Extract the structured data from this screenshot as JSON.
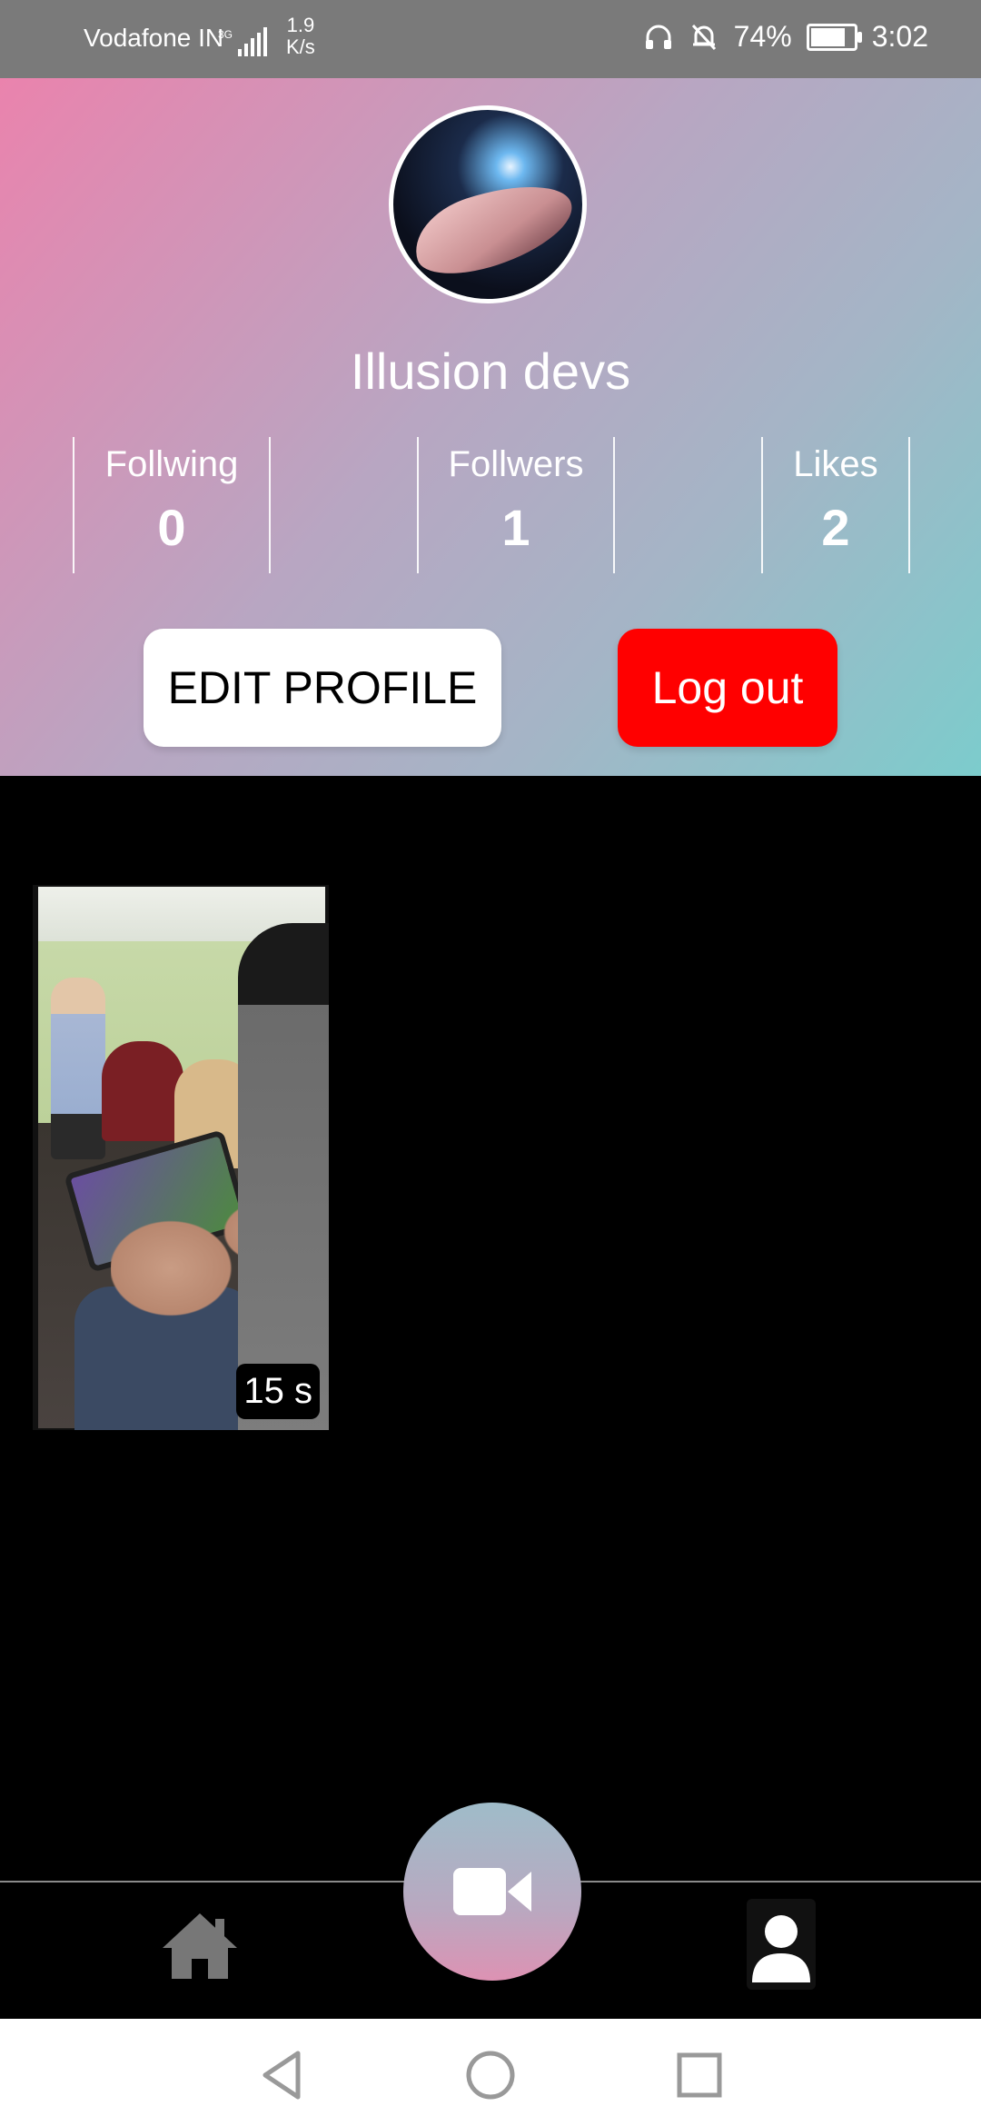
{
  "status_bar": {
    "carrier": "Vodafone IN",
    "network": "3G",
    "speed_value": "1.9",
    "speed_unit": "K/s",
    "battery": "74%",
    "time": "3:02"
  },
  "profile": {
    "username": "Illusion devs",
    "stats": [
      {
        "label": "Follwing",
        "value": "0"
      },
      {
        "label": "Follwers",
        "value": "1"
      },
      {
        "label": "Likes",
        "value": "2"
      }
    ],
    "edit_button": "EDIT PROFILE",
    "logout_button": "Log out"
  },
  "videos": [
    {
      "duration": "15 s"
    }
  ],
  "nav": {
    "home_icon": "home-icon",
    "record_icon": "video-camera-icon",
    "profile_icon": "user-icon"
  },
  "colors": {
    "logout": "#ff0000",
    "gradient_start": "#ea83ad",
    "gradient_end": "#7ccccc"
  }
}
